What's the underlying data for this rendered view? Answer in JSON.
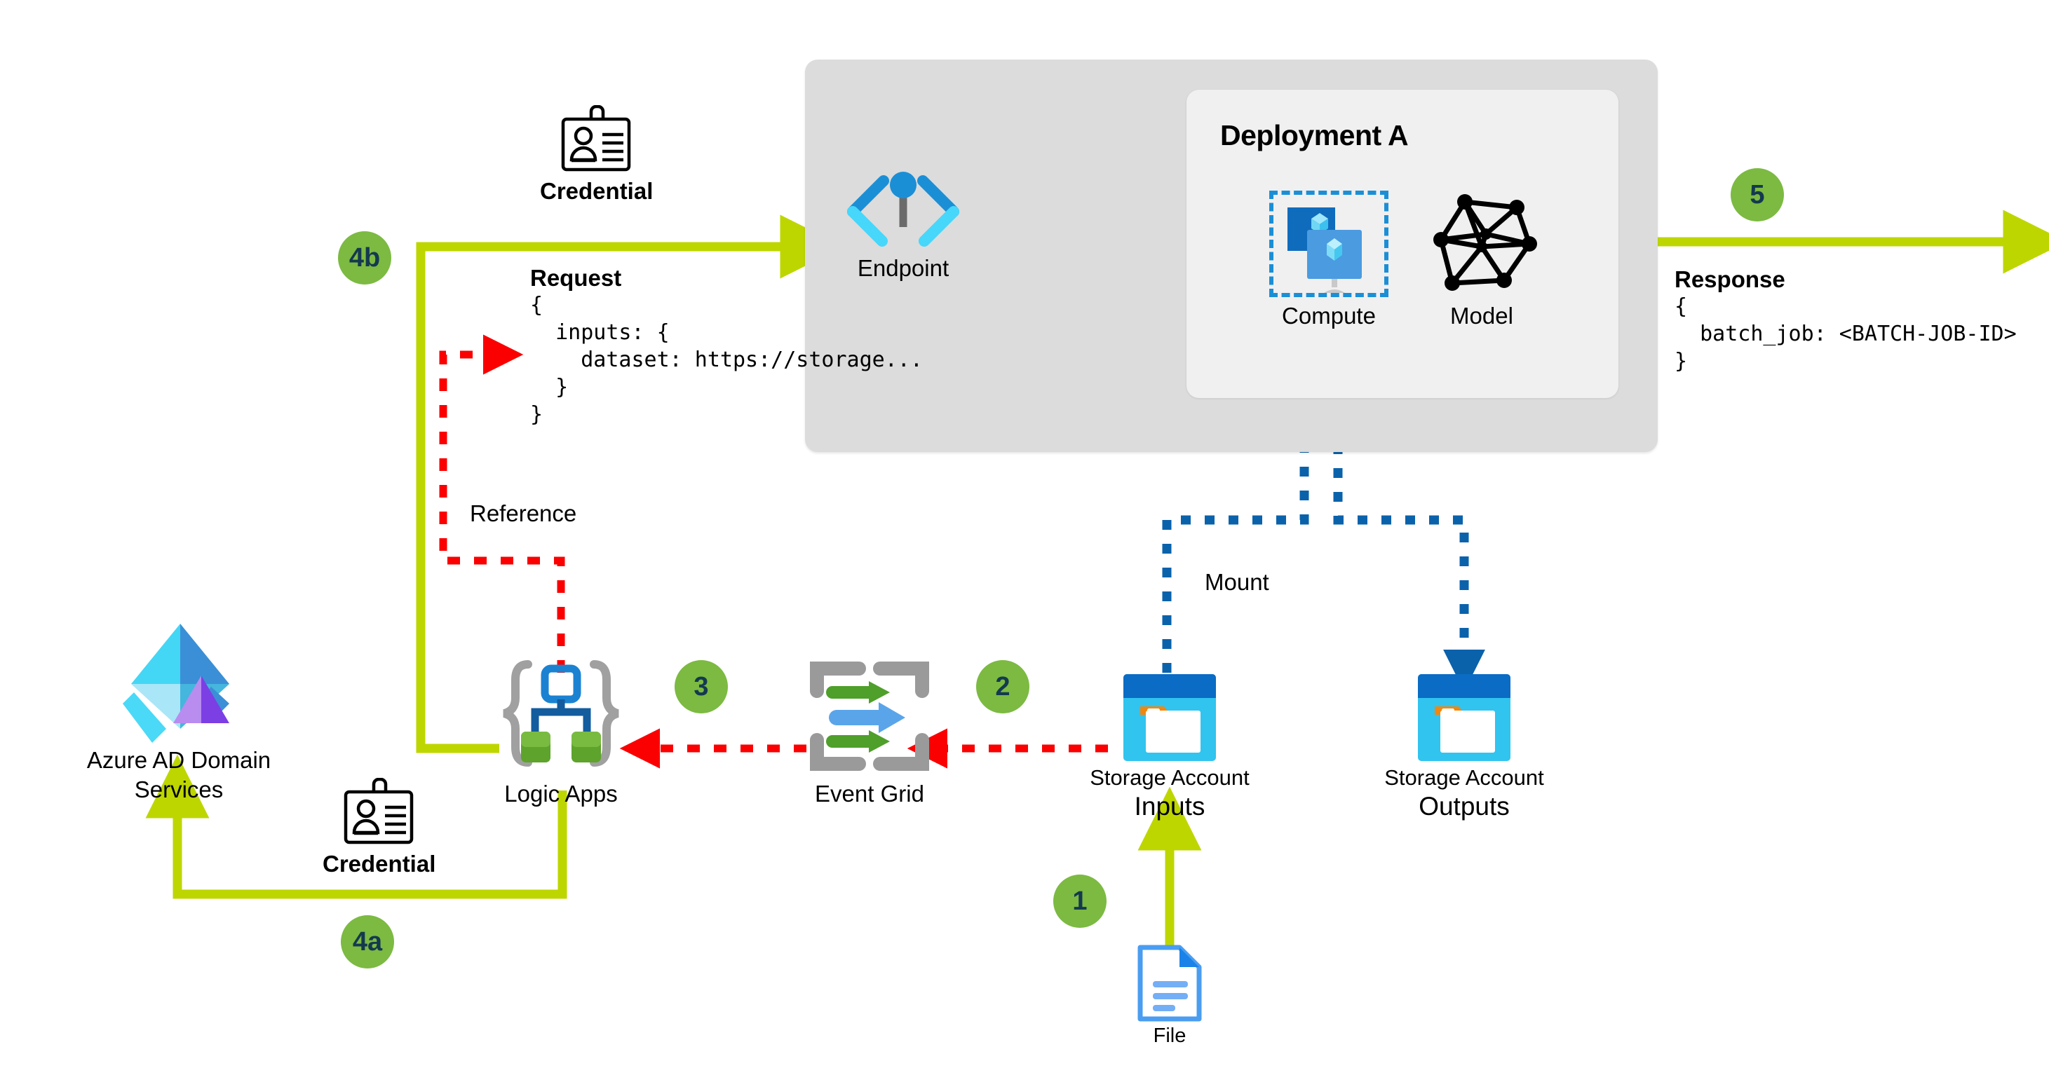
{
  "diagram": {
    "title": "Azure Machine Learning batch endpoint event-driven architecture",
    "colors": {
      "green_arrow": "#bed600",
      "badge_fill": "#7cba42",
      "badge_text": "#14394f",
      "blue_dotted": "#0a62ab",
      "red_dotted": "#fa0000",
      "outer_box": "#dcdcdc",
      "inner_box": "#f0f0f0",
      "azure_blue": "#0078d4",
      "cyan": "#32bedd"
    }
  },
  "containers": {
    "deployment_title": "Deployment A"
  },
  "nodes": {
    "credential_top": "Credential",
    "credential_bottom": "Credential",
    "endpoint": "Endpoint",
    "compute": "Compute",
    "model": "Model",
    "azure_ad": "Azure AD Domain\nServices",
    "logic_apps": "Logic Apps",
    "event_grid": "Event Grid",
    "storage_inputs_line1": "Storage Account",
    "storage_inputs_line2": "Inputs",
    "storage_outputs_line1": "Storage Account",
    "storage_outputs_line2": "Outputs",
    "file": "File"
  },
  "edge_labels": {
    "reference": "Reference",
    "mount": "Mount"
  },
  "steps": [
    {
      "id": "1",
      "label": "1"
    },
    {
      "id": "2",
      "label": "2"
    },
    {
      "id": "3",
      "label": "3"
    },
    {
      "id": "4a",
      "label": "4a"
    },
    {
      "id": "4b",
      "label": "4b"
    },
    {
      "id": "5",
      "label": "5"
    }
  ],
  "request": {
    "title": "Request",
    "body": "{\n  inputs: {\n    dataset: https://storage...\n  }\n}"
  },
  "response": {
    "title": "Response",
    "body": "{\n  batch_job: <BATCH-JOB-ID>\n}"
  }
}
